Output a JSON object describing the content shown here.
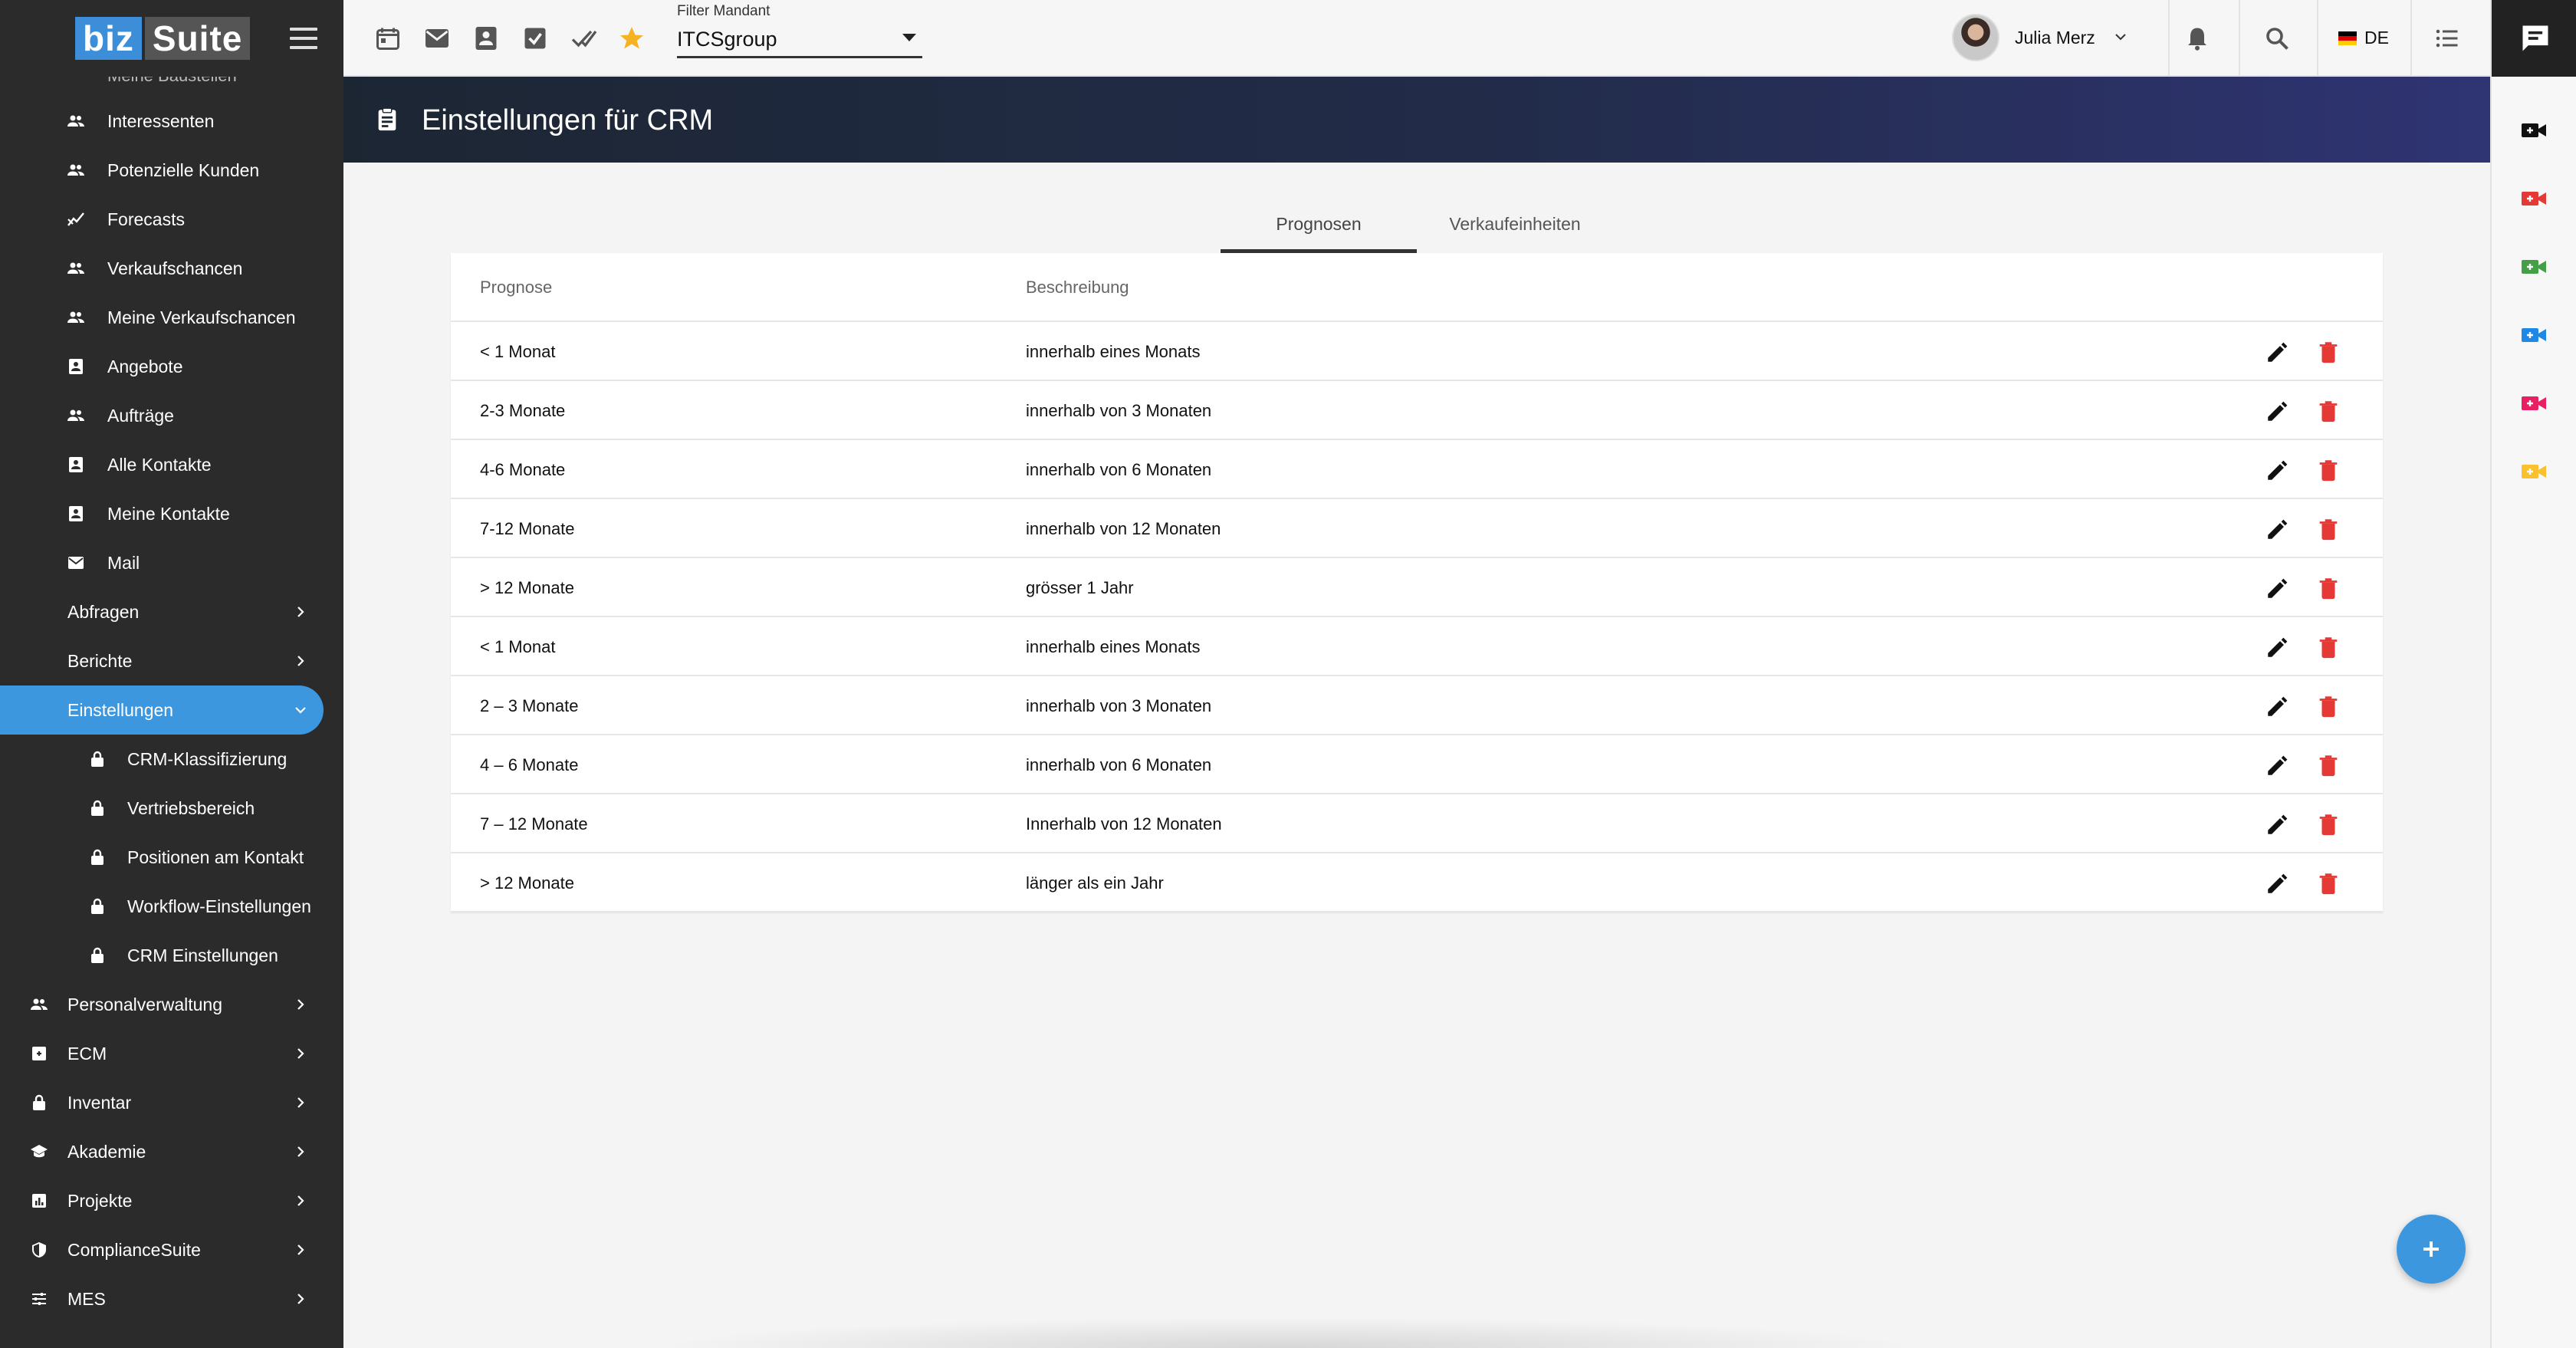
{
  "app": {
    "logo_biz": "biz",
    "logo_suite": "Suite",
    "cutoff_item": "Meine Baustellen"
  },
  "sidebar": {
    "items": [
      {
        "label": "Interessenten",
        "icon": "people-icon"
      },
      {
        "label": "Potenzielle Kunden",
        "icon": "people-icon"
      },
      {
        "label": "Forecasts",
        "icon": "trend-icon"
      },
      {
        "label": "Verkaufschancen",
        "icon": "people-icon"
      },
      {
        "label": "Meine Verkaufschancen",
        "icon": "people-icon"
      },
      {
        "label": "Angebote",
        "icon": "contact-card-icon"
      },
      {
        "label": "Aufträge",
        "icon": "people-icon"
      },
      {
        "label": "Alle Kontakte",
        "icon": "contact-card-icon"
      },
      {
        "label": "Meine Kontakte",
        "icon": "contact-card-icon"
      },
      {
        "label": "Mail",
        "icon": "mail-icon"
      }
    ],
    "groups": [
      {
        "label": "Abfragen"
      },
      {
        "label": "Berichte"
      },
      {
        "label": "Einstellungen"
      }
    ],
    "settings_sub": [
      {
        "label": "CRM-Klassifizierung",
        "icon": "lock-icon"
      },
      {
        "label": "Vertriebsbereich",
        "icon": "lock-icon"
      },
      {
        "label": "Positionen am Kontakt",
        "icon": "lock-icon"
      },
      {
        "label": "Workflow-Einstellungen",
        "icon": "lock-icon"
      },
      {
        "label": "CRM Einstellungen",
        "icon": "lock-icon"
      }
    ],
    "modules": [
      {
        "label": "Personalverwaltung",
        "icon": "people-icon"
      },
      {
        "label": "ECM",
        "icon": "archive-icon"
      },
      {
        "label": "Inventar",
        "icon": "lock-icon"
      },
      {
        "label": "Akademie",
        "icon": "school-icon"
      },
      {
        "label": "Projekte",
        "icon": "chart-icon"
      },
      {
        "label": "ComplianceSuite",
        "icon": "shield-icon"
      },
      {
        "label": "MES",
        "icon": "sliders-icon"
      }
    ]
  },
  "topbar": {
    "filter_label": "Filter Mandant",
    "filter_value": "ITCSgroup",
    "user_name": "Julia Merz",
    "language": "DE",
    "star_color": "#f5b323"
  },
  "page": {
    "title": "Einstellungen für CRM",
    "tabs": [
      "Prognosen",
      "Verkaufeinheiten"
    ],
    "active_tab": "Prognosen"
  },
  "table": {
    "headers": [
      "Prognose",
      "Beschreibung"
    ],
    "rows": [
      {
        "prognose": "< 1 Monat",
        "beschreibung": "innerhalb eines Monats"
      },
      {
        "prognose": "2-3 Monate",
        "beschreibung": "innerhalb von 3 Monaten"
      },
      {
        "prognose": "4-6 Monate",
        "beschreibung": "innerhalb von 6 Monaten"
      },
      {
        "prognose": "7-12 Monate",
        "beschreibung": "innerhalb von 12 Monaten"
      },
      {
        "prognose": "> 12 Monate",
        "beschreibung": "grösser 1 Jahr"
      },
      {
        "prognose": "< 1 Monat",
        "beschreibung": "innerhalb eines Monats"
      },
      {
        "prognose": "2 – 3 Monate",
        "beschreibung": "innerhalb von 3 Monaten"
      },
      {
        "prognose": "4 – 6 Monate",
        "beschreibung": "innerhalb von 6 Monaten"
      },
      {
        "prognose": "7 – 12 Monate",
        "beschreibung": "Innerhalb von 12 Monaten"
      },
      {
        "prognose": "> 12 Monate",
        "beschreibung": "länger als ein Jahr"
      }
    ]
  },
  "colors": {
    "sidebar_bg": "#2b2b2b",
    "accent": "#3d97df",
    "delete": "#e53935",
    "rail_cams": [
      "#111111",
      "#e53935",
      "#43a047",
      "#1e88e5",
      "#e91e63",
      "#fbc02d"
    ]
  }
}
